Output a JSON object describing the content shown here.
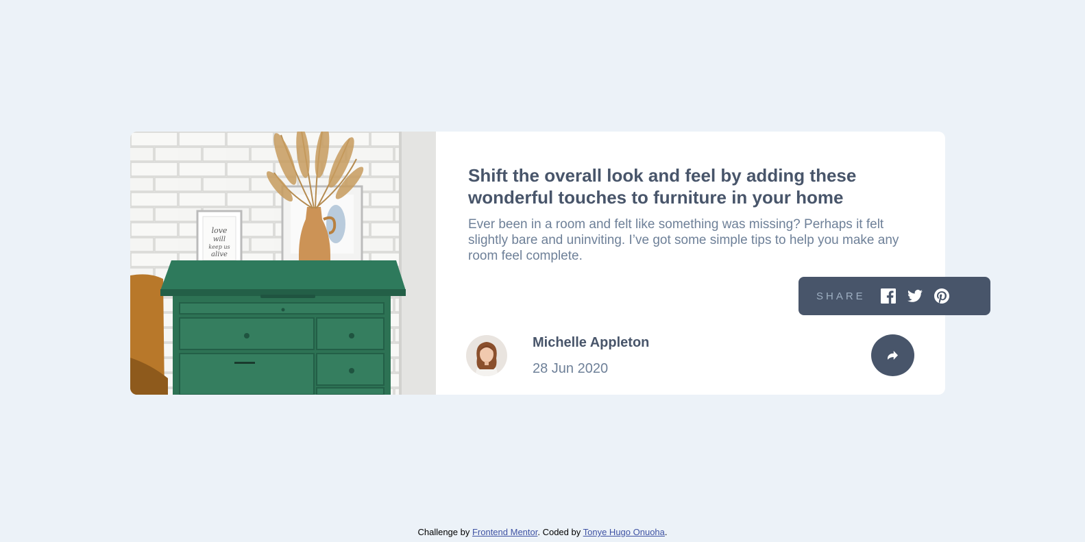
{
  "article": {
    "title": "Shift the overall look and feel by adding these wonderful touches to furniture in your home",
    "excerpt": "Ever been in a room and felt like something was missing? Perhaps it felt slightly bare and uninviting. I’ve got some simple tips to help you make any room feel complete."
  },
  "author": {
    "name": "Michelle Appleton",
    "date": "28 Jun 2020"
  },
  "share": {
    "label": "SHARE",
    "icons": [
      "facebook-icon",
      "twitter-icon",
      "pinterest-icon"
    ],
    "toggle_icon": "share-arrow-icon"
  },
  "footer": {
    "prefix": "Challenge by ",
    "link1": "Frontend Mentor",
    "middle": ". Coded by ",
    "link2": "Tonye Hugo Onuoha",
    "suffix": "."
  },
  "colors": {
    "background": "#ecf2f8",
    "card": "#ffffff",
    "dark_blue": "#48556a",
    "grayish_blue": "#6e8098",
    "light_grayish_blue": "#9eafc2",
    "link": "#3e52a3"
  }
}
